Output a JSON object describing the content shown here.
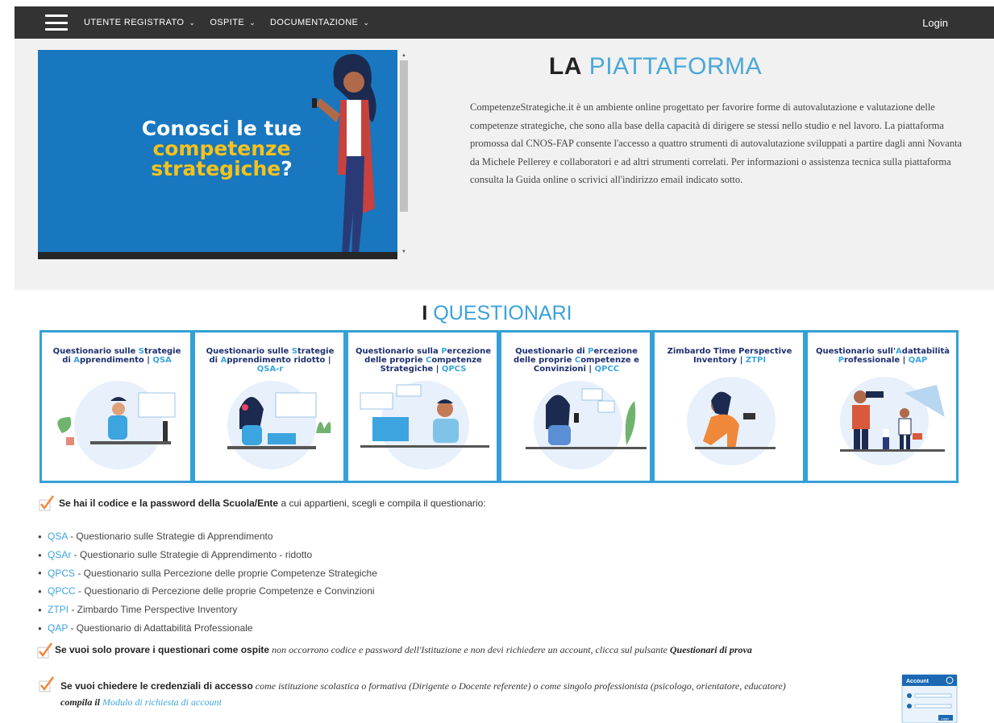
{
  "nav": {
    "items": [
      {
        "label": "UTENTE REGISTRATO"
      },
      {
        "label": "OSPITE"
      },
      {
        "label": "DOCUMENTAZIONE"
      }
    ],
    "login_label": "Login"
  },
  "hero": {
    "slide_text_line1": "Conosci le tue",
    "slide_text_line2": "competenze",
    "slide_text_line3": "strategiche",
    "slide_text_qmark": "?",
    "title_bold": "LA",
    "title_light": "PIATTAFORMA",
    "description": "CompetenzeStrategiche.it è un ambiente online progettato per favorire forme di autovalutazione e valutazione delle competenze strategiche, che sono alla base della capacità di dirigere se stessi nello studio e nel lavoro. La piattaforma promossa dal CNOS-FAP consente l'accesso a quattro strumenti di autovalutazione sviluppati a partire dagli anni Novanta da Michele Pellerey e collaboratori e ad altri strumenti correlati. Per informazioni o assistenza tecnica sulla piattaforma consulta la Guida online o scrivici all'indirizzo email indicato sotto."
  },
  "questionari": {
    "title_bold": "I",
    "title_light": "QUESTIONARI",
    "cards": [
      {
        "t1": "Questionario sulle ",
        "h1": "S",
        "t2": "trategie di ",
        "h2": "A",
        "t3": "pprendimento | ",
        "code": "QSA"
      },
      {
        "t1": "Questionario sulle ",
        "h1": "S",
        "t2": "trategie di ",
        "h2": "A",
        "t3": "pprendimento ridotto | ",
        "code": "QSA-r"
      },
      {
        "t1": "Questionario sulla ",
        "h1": "P",
        "t2": "ercezione delle proprie ",
        "h2": "C",
        "t3": "ompetenze Strategiche | ",
        "code": "QPCS"
      },
      {
        "t1": "Questionario di ",
        "h1": "P",
        "t2": "ercezione delle proprie ",
        "h2": "C",
        "t3": "ompetenze e Convinzioni | ",
        "code": "QPCC"
      },
      {
        "t1": "Zimbardo Time Perspective ",
        "h1": "",
        "t2": "",
        "h2": "",
        "t3": "Inventory | ",
        "code": "ZTPI"
      },
      {
        "t1": "Questionario  sull'",
        "h1": "A",
        "t2": "dattabilità ",
        "h2": "P",
        "t3": "rofessionale | ",
        "code": "QAP"
      }
    ]
  },
  "instructions": {
    "p1_bold": "Se hai il codice e la password della Scuola/Ente",
    "p1_rest": " a cui appartieni, scegli e compila il questionario:",
    "list": [
      {
        "code": "QSA",
        "text": " - Questionario sulle Strategie di Apprendimento"
      },
      {
        "code": "QSAr",
        "text": " - Questionario sulle Strategie di Apprendimento - ridotto"
      },
      {
        "code": "QPCS",
        "text": " - Questionario sulla Percezione delle proprie Competenze Strategiche"
      },
      {
        "code": "QPCC",
        "text": " - Questionario di Percezione delle proprie Competenze e Convinzioni"
      },
      {
        "code": "ZTPI",
        "text": " - Zimbardo Time Perspective Inventory"
      },
      {
        "code": "QAP",
        "text": " - Questionario di Adattabilità Professionale"
      }
    ],
    "p2_bold": "Se vuoi solo provare i questionari come ospite",
    "p2_italic": " non occorrono codice e password dell'Istituzione e non devi richiedere un account, clicca sul pulsante ",
    "p2_bold_italic": "Questionari di prova",
    "p3_bold": "Se vuoi chiedere le credenziali di accesso",
    "p3_italic": " come istituzione scolastica o formativa (Dirigente o Docente referente) o come singolo professionista (psicologo, orientatore, educatore) ",
    "p3_compila": "compila il ",
    "p3_link": "Modulo di richiesta di account",
    "account_icon_label": "Account",
    "account_icon_btn": "Login"
  },
  "colors": {
    "accent": "#3ca4de",
    "nav_bg": "#333333",
    "slide_bg": "#1877be",
    "check": "#f0883a"
  }
}
